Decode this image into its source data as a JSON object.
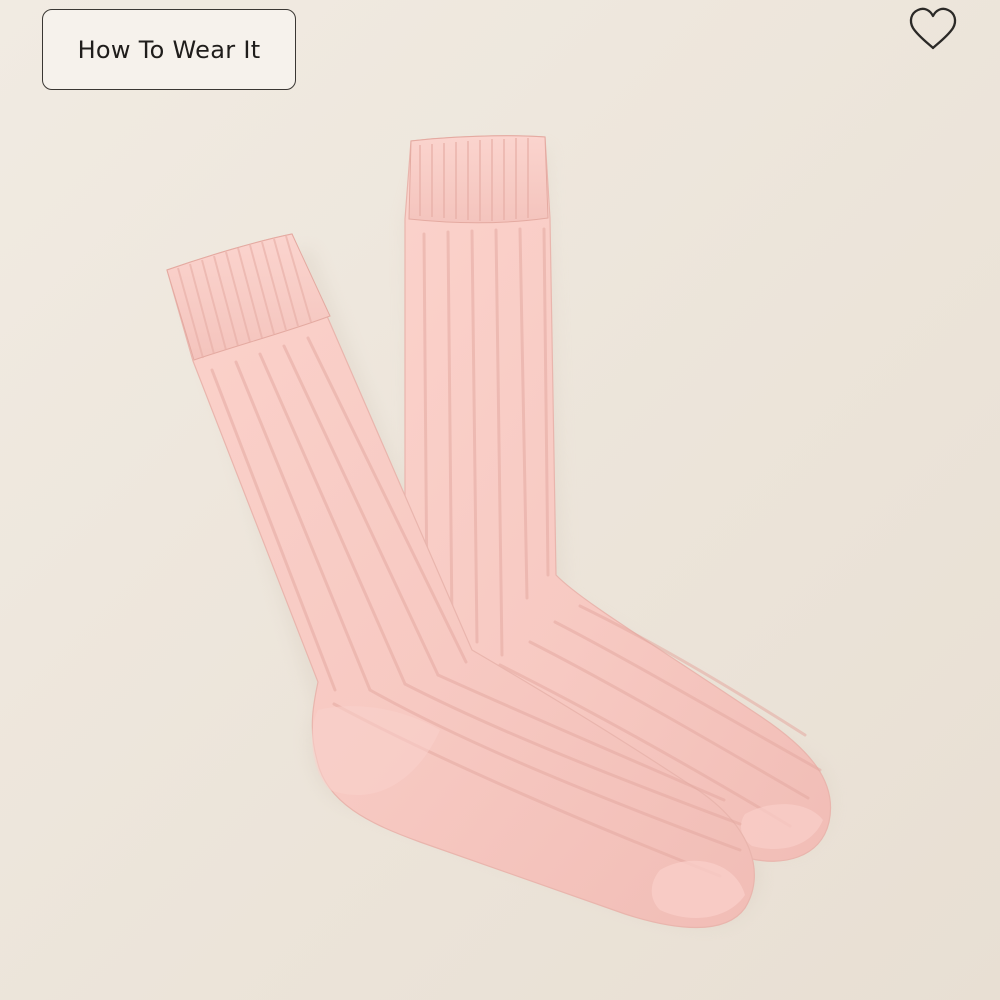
{
  "page": {
    "background_color": "#eee7dd"
  },
  "product": {
    "image_icon": "pink-ribbed-crew-socks-image",
    "sock_color": "#f7c9c2"
  },
  "controls": {
    "how_to_wear_label": "How To Wear It",
    "favorite_icon": "heart-icon"
  }
}
